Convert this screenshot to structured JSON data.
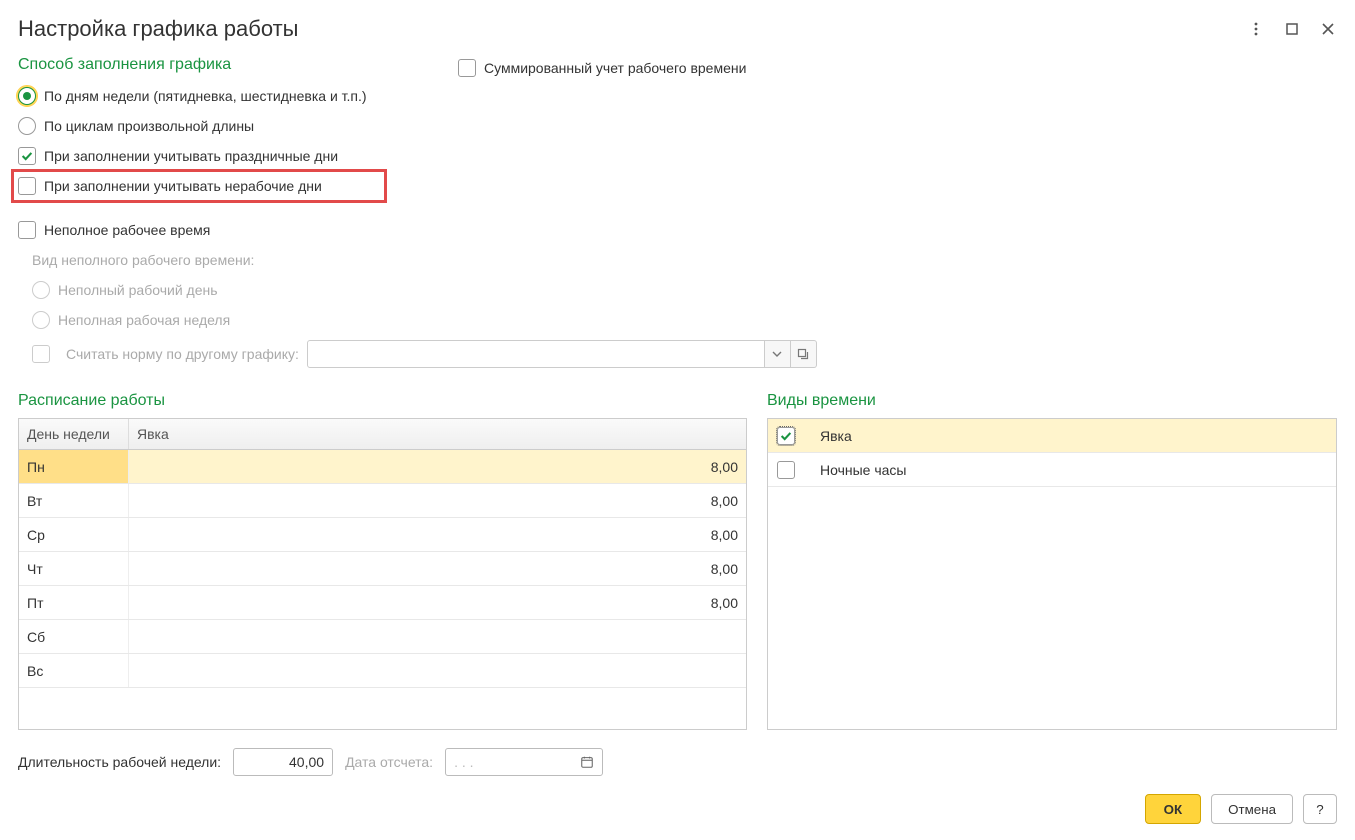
{
  "window": {
    "title": "Настройка графика работы"
  },
  "fillMethod": {
    "heading": "Способ заполнения графика",
    "byWeekDays": "По дням недели (пятидневка, шестидневка и т.п.)",
    "byCycles": "По циклам произвольной длины",
    "considerHolidays": "При заполнении учитывать праздничные дни",
    "considerNonWorking": "При заполнении учитывать нерабочие дни"
  },
  "summed": {
    "label": "Суммированный учет рабочего времени"
  },
  "partTime": {
    "heading": "Неполное рабочее время",
    "kindLabel": "Вид неполного рабочего времени:",
    "partDay": "Неполный рабочий день",
    "partWeek": "Неполная рабочая неделя",
    "normByOther": "Считать норму по другому графику:"
  },
  "schedule": {
    "heading": "Расписание работы",
    "colDay": "День недели",
    "colAttendance": "Явка",
    "rows": [
      {
        "day": "Пн",
        "att": "8,00"
      },
      {
        "day": "Вт",
        "att": "8,00"
      },
      {
        "day": "Ср",
        "att": "8,00"
      },
      {
        "day": "Чт",
        "att": "8,00"
      },
      {
        "day": "Пт",
        "att": "8,00"
      },
      {
        "day": "Сб",
        "att": ""
      },
      {
        "day": "Вс",
        "att": ""
      }
    ]
  },
  "timeTypes": {
    "heading": "Виды времени",
    "rows": [
      {
        "label": "Явка",
        "checked": true
      },
      {
        "label": "Ночные часы",
        "checked": false
      }
    ]
  },
  "bottom": {
    "weekDurationLabel": "Длительность рабочей недели:",
    "weekDurationValue": "40,00",
    "dateFromLabel": "Дата отсчета:",
    "dateFromPlaceholder": ".   .   ."
  },
  "footer": {
    "ok": "ОК",
    "cancel": "Отмена",
    "help": "?"
  }
}
